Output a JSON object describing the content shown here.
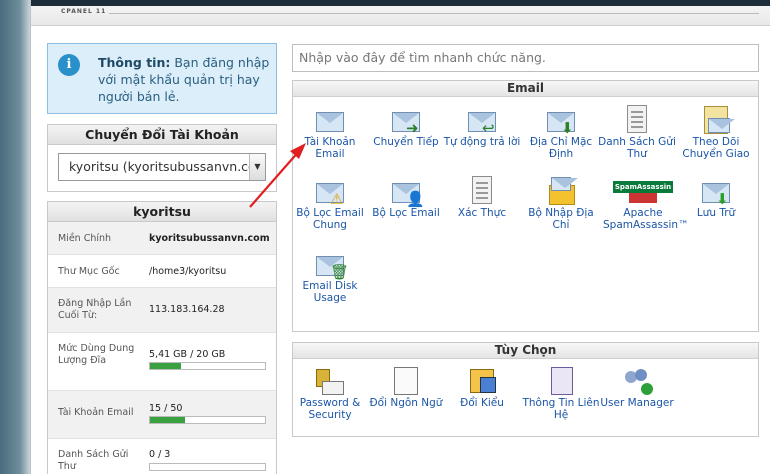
{
  "brand": "CPANEL 11",
  "info": {
    "icon": "info-icon",
    "title": "Thông tin:",
    "text": "Bạn đăng nhập với mật khẩu quản trị hay người bán lẻ."
  },
  "switch_account": {
    "title": "Chuyển Đổi Tài Khoản",
    "selected": "kyoritsu (kyoritsubussanvn.co"
  },
  "account": {
    "title": "kyoritsu",
    "rows": [
      {
        "label": "Miền Chính",
        "value": "kyoritsubussanvn.com"
      },
      {
        "label": "Thư Mục Gốc",
        "value": "/home3/kyoritsu"
      },
      {
        "label": "Đăng Nhập Lần Cuối Từ:",
        "value": "113.183.164.28"
      },
      {
        "label": "Mức Dùng Dung Lượng Đĩa",
        "value": "5,41 GB / 20 GB",
        "progress": 0.27
      },
      {
        "label": "Tài Khoản Email",
        "value": "15 / 50",
        "progress": 0.3
      },
      {
        "label": "Danh Sách Gửi Thư",
        "value": "0 / 3",
        "progress": 0
      }
    ]
  },
  "search": {
    "placeholder": "Nhập vào đây để tìm nhanh chức năng."
  },
  "email_panel": {
    "title": "Email",
    "items": [
      {
        "label": "Tài Khoản Email",
        "icon": "email-accounts-icon"
      },
      {
        "label": "Chuyển Tiếp",
        "icon": "forwarders-icon"
      },
      {
        "label": "Tự động trả lời",
        "icon": "autoresponders-icon"
      },
      {
        "label": "Địa Chỉ Mặc Định",
        "icon": "default-address-icon"
      },
      {
        "label": "Danh Sách Gửi Thư",
        "icon": "mailing-lists-icon"
      },
      {
        "label": "Theo Dõi Chuyển Giao",
        "icon": "track-delivery-icon"
      },
      {
        "label": "Bộ Lọc Email Chung",
        "icon": "global-email-filters-icon"
      },
      {
        "label": "Bộ Lọc Email",
        "icon": "email-filters-icon"
      },
      {
        "label": "Xác Thực",
        "icon": "authentication-icon"
      },
      {
        "label": "Bộ Nhập Địa Chỉ",
        "icon": "address-importer-icon"
      },
      {
        "label": "Apache SpamAssassin™",
        "icon": "spamassassin-icon",
        "badge": "SpamAssassin"
      },
      {
        "label": "Lưu Trữ",
        "icon": "archive-icon"
      },
      {
        "label": "Email Disk Usage",
        "icon": "email-disk-usage-icon"
      }
    ]
  },
  "options_panel": {
    "title": "Tùy Chọn",
    "items": [
      {
        "label": "Password & Security",
        "icon": "password-security-icon"
      },
      {
        "label": "Đổi Ngôn Ngữ",
        "icon": "change-language-icon"
      },
      {
        "label": "Đổi Kiểu",
        "icon": "change-style-icon"
      },
      {
        "label": "Thông Tin Liên Hệ",
        "icon": "contact-info-icon"
      },
      {
        "label": "User Manager",
        "icon": "user-manager-icon"
      }
    ]
  },
  "colors": {
    "link": "#1a55a6",
    "progress": "#3aa141",
    "annotation_arrow": "#e02020",
    "info_bg": "#dbeef9"
  }
}
